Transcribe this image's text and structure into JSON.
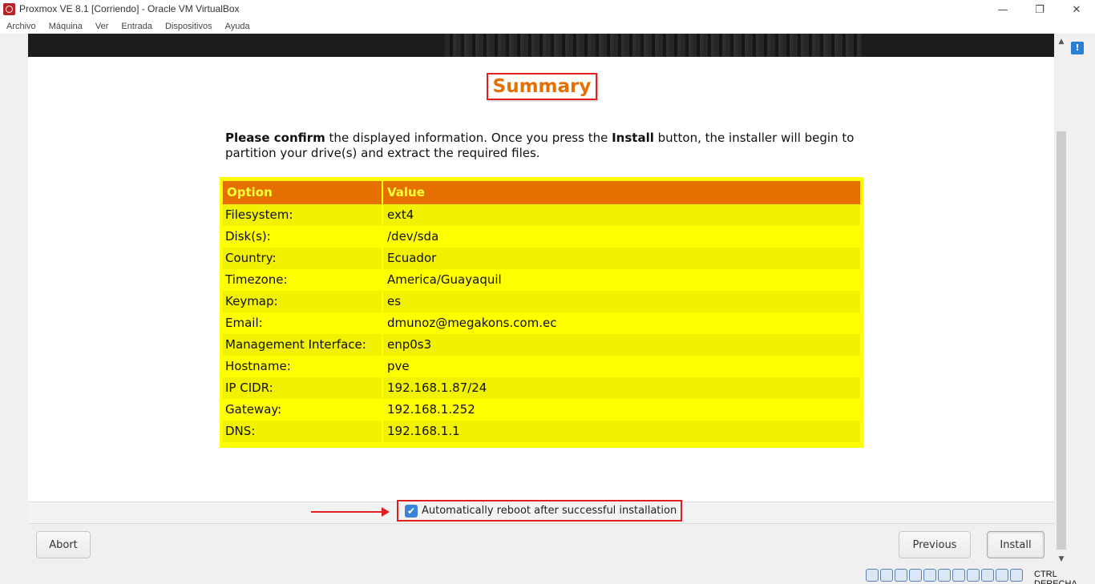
{
  "window": {
    "title": "Proxmox VE 8.1 [Corriendo] - Oracle VM VirtualBox",
    "minimize": "—",
    "restore": "❐",
    "close": "✕"
  },
  "menu": [
    "Archivo",
    "Máquina",
    "Ver",
    "Entrada",
    "Dispositivos",
    "Ayuda"
  ],
  "installer": {
    "title": "Summary",
    "intro_bold1": "Please confirm",
    "intro_part1": " the displayed information. Once you press the ",
    "intro_bold2": "Install",
    "intro_part2": " button, the installer will begin to partition your drive(s) and extract the required files.",
    "table": {
      "headers": [
        "Option",
        "Value"
      ],
      "rows": [
        [
          "Filesystem:",
          "ext4"
        ],
        [
          "Disk(s):",
          "/dev/sda"
        ],
        [
          "Country:",
          "Ecuador"
        ],
        [
          "Timezone:",
          "America/Guayaquil"
        ],
        [
          "Keymap:",
          "es"
        ],
        [
          "Email:",
          "dmunoz@megakons.com.ec"
        ],
        [
          "Management Interface:",
          "enp0s3"
        ],
        [
          "Hostname:",
          "pve"
        ],
        [
          "IP CIDR:",
          "192.168.1.87/24"
        ],
        [
          "Gateway:",
          "192.168.1.252"
        ],
        [
          "DNS:",
          "192.168.1.1"
        ]
      ]
    },
    "reboot_label": "Automatically reboot after successful installation",
    "reboot_checked": true,
    "buttons": {
      "abort": "Abort",
      "previous": "Previous",
      "install": "Install"
    }
  },
  "statusbar": {
    "host_key": "CTRL DERECHA",
    "icon_names": [
      "hdd-icon",
      "optical-icon",
      "audio-icon",
      "network-icon",
      "usb-icon",
      "shared-folder-icon",
      "display-icon",
      "recording-icon",
      "cpu-icon",
      "mouse-integration-icon",
      "keyboard-icon"
    ]
  },
  "colors": {
    "accent_orange": "#e57000",
    "table_yellow": "#ffff00",
    "highlight_red": "#e02020"
  }
}
